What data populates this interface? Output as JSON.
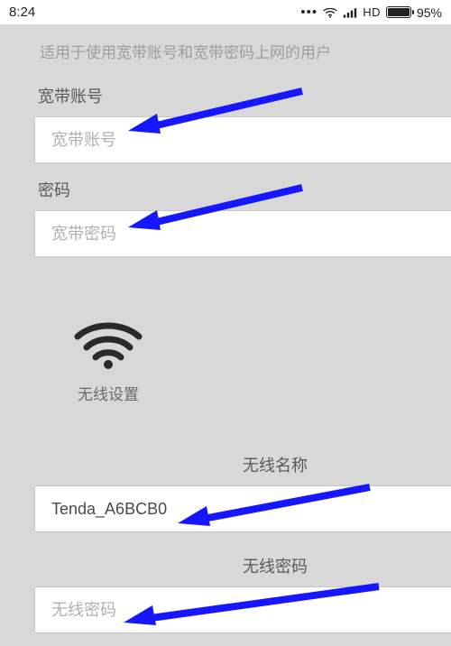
{
  "status_bar": {
    "time": "8:24",
    "hd": "HD",
    "battery_pct": "95%"
  },
  "hint": "适用于使用宽带账号和宽带密码上网的用户",
  "broadband": {
    "account_label": "宽带账号",
    "account_placeholder": "宽带账号",
    "account_value": "",
    "password_label": "密码",
    "password_placeholder": "宽带密码",
    "password_value": ""
  },
  "wifi": {
    "section_label": "无线设置",
    "name_label": "无线名称",
    "name_value": "Tenda_A6BCB0",
    "password_label": "无线密码",
    "password_placeholder": "无线密码",
    "password_value": ""
  }
}
